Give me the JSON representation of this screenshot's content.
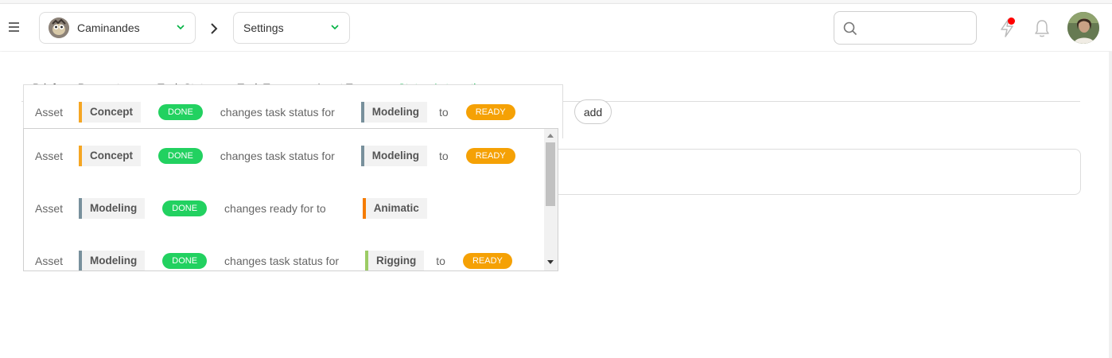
{
  "header": {
    "production": {
      "name": "Caminandes"
    },
    "section": {
      "name": "Settings"
    },
    "search": {
      "placeholder": ""
    },
    "notification_dot_color": "#ff0000"
  },
  "tabs": [
    "Brief",
    "Parameters",
    "Task Status",
    "Task Types",
    "Asset Types",
    "Status Automations"
  ],
  "active_tab": "Status Automations",
  "colors": {
    "accent": "#00b242",
    "done": "#22d160",
    "ready": "#f5a105",
    "concept_bar": "#f5a623",
    "modeling_bar": "#78909c",
    "animatic_bar": "#f57c00",
    "rigging_bar": "#9ccc65"
  },
  "automation_select": {
    "selected": {
      "entity": "Asset",
      "in_task": "Concept",
      "in_status": "done",
      "action": "changes task status for",
      "out_task": "Modeling",
      "to_label": "to",
      "out_status": "ready"
    },
    "add_label": "add",
    "options": [
      {
        "entity": "Asset",
        "in_task": "Concept",
        "in_status": "done",
        "action": "changes task status for",
        "out_task": "Modeling",
        "to_label": "to",
        "out_status": "ready"
      },
      {
        "entity": "Asset",
        "in_task": "Modeling",
        "in_status": "done",
        "action": "changes ready for to",
        "out_task": "Animatic"
      },
      {
        "entity": "Asset",
        "in_task": "Modeling",
        "in_status": "done",
        "action": "changes task status for",
        "out_task": "Rigging",
        "to_label": "to",
        "out_status": "ready"
      }
    ]
  }
}
